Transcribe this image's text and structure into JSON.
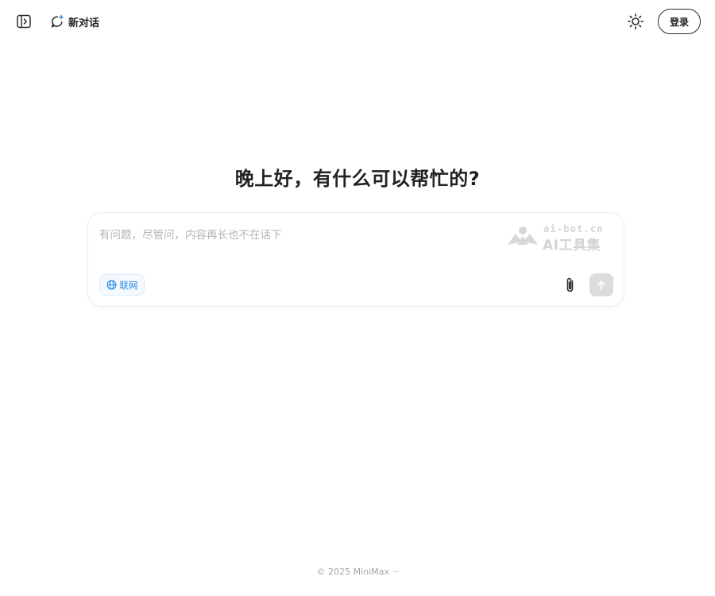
{
  "header": {
    "new_chat_label": "新对话",
    "login_label": "登录"
  },
  "main": {
    "greeting": "晚上好，有什么可以帮忙的?"
  },
  "composer": {
    "placeholder": "有问题，尽管问，内容再长也不在话下",
    "value": "",
    "web_search_label": "联网"
  },
  "watermark": {
    "line1": "ai-bot.cn",
    "line2": "AI工具集"
  },
  "footer": {
    "copyright": "© 2025 MiniMax",
    "more": "···"
  },
  "colors": {
    "accent_blue": "#2a8de0",
    "chip_bg": "#f3f9ff",
    "send_disabled": "#dcdcdc",
    "text_primary": "#222222",
    "placeholder": "#b3b3b3"
  }
}
